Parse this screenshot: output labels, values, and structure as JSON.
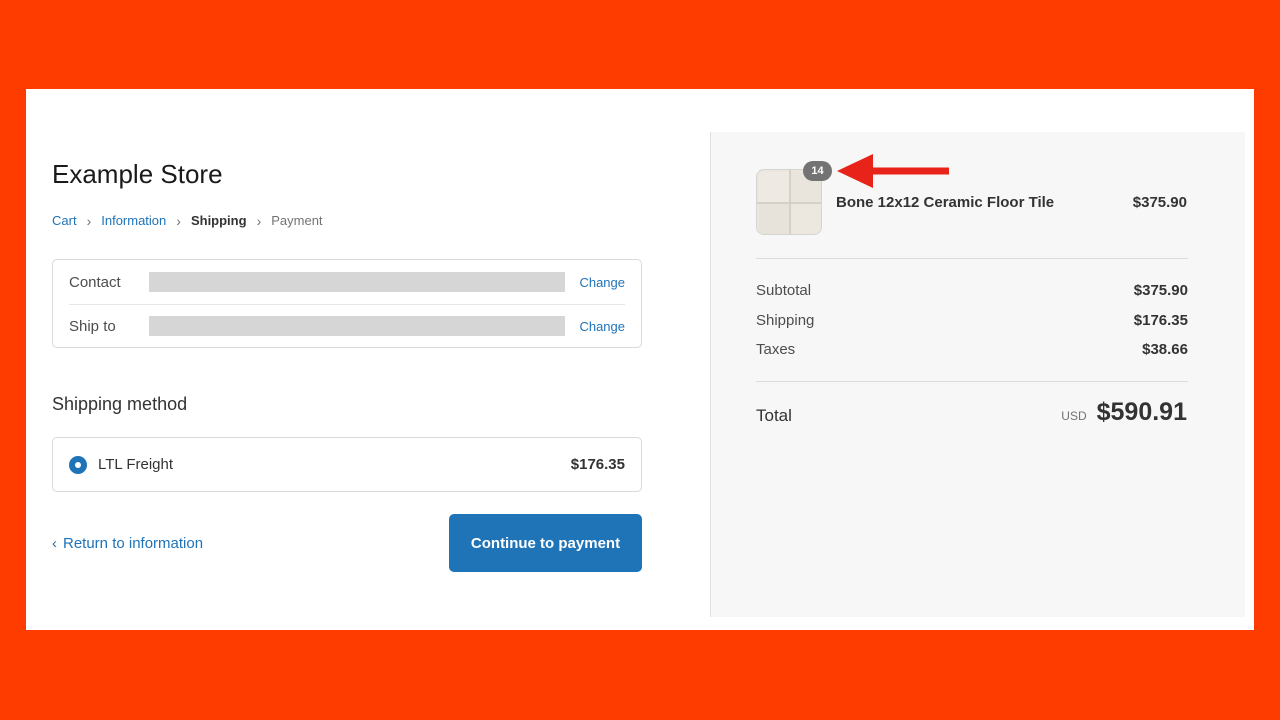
{
  "store": {
    "title": "Example Store"
  },
  "breadcrumb": {
    "cart": "Cart",
    "information": "Information",
    "shipping": "Shipping",
    "payment": "Payment",
    "separator_icon": "chevron-right-icon"
  },
  "review": {
    "contact_label": "Contact",
    "ship_to_label": "Ship to",
    "change_label": "Change"
  },
  "shipping_method": {
    "heading": "Shipping method",
    "option_label": "LTL Freight",
    "option_price": "$176.35",
    "selected": true
  },
  "actions": {
    "return_label": "Return to information",
    "continue_label": "Continue to payment"
  },
  "summary": {
    "product": {
      "name": "Bone 12x12 Ceramic Floor Tile",
      "price": "$375.90",
      "quantity": "14"
    },
    "subtotal_label": "Subtotal",
    "subtotal": "$375.90",
    "shipping_label": "Shipping",
    "shipping": "$176.35",
    "taxes_label": "Taxes",
    "taxes": "$38.66",
    "total_label": "Total",
    "currency": "USD",
    "total": "$590.91"
  },
  "colors": {
    "accent": "#1f73b7",
    "background_frame": "#ff3c00",
    "annotation_arrow": "#e8231a"
  }
}
